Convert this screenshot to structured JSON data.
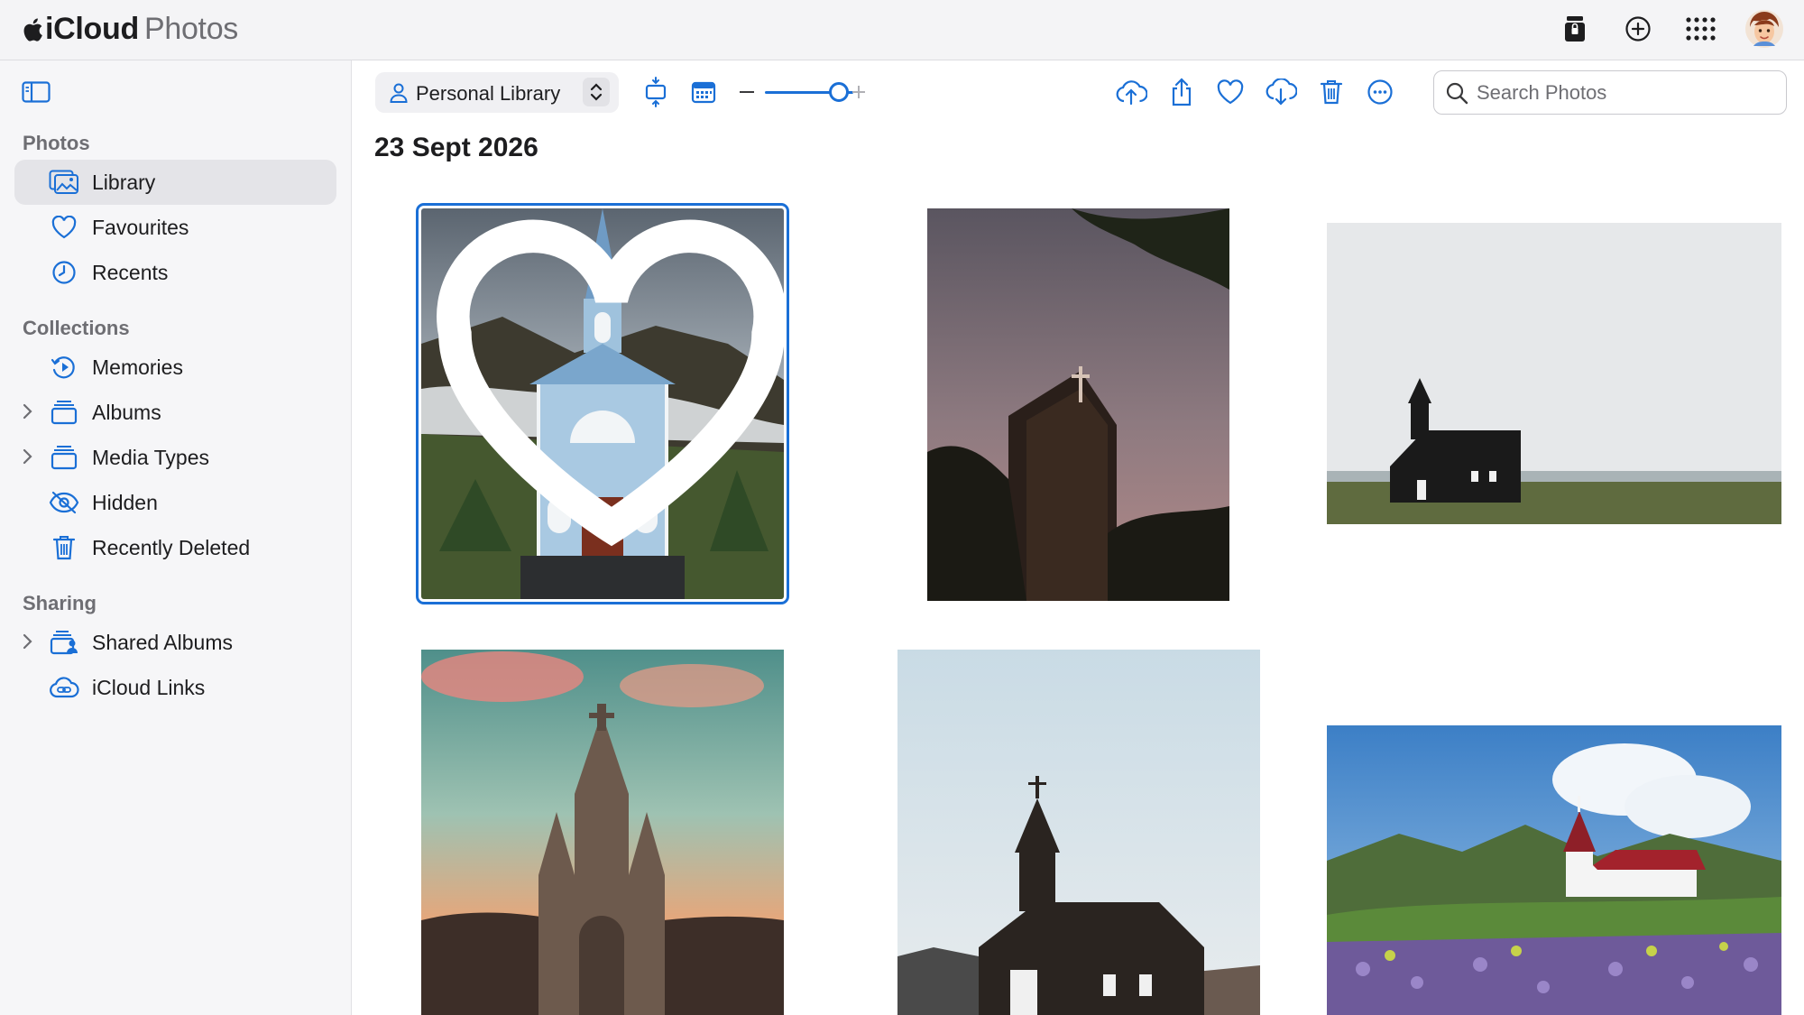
{
  "app": {
    "brand_main": "iCloud",
    "brand_sub": "Photos",
    "top_icons": [
      "icloud-drive-lock-icon",
      "add-icon",
      "app-grid-icon",
      "avatar"
    ]
  },
  "sidebar": {
    "sections": {
      "photos": "Photos",
      "collections": "Collections",
      "sharing": "Sharing"
    },
    "items": [
      {
        "label": "Library",
        "icon": "library-icon",
        "active": true
      },
      {
        "label": "Favourites",
        "icon": "heart-icon"
      },
      {
        "label": "Recents",
        "icon": "clock-icon"
      },
      {
        "label": "Memories",
        "icon": "memories-icon"
      },
      {
        "label": "Albums",
        "icon": "album-icon",
        "expandable": true
      },
      {
        "label": "Media Types",
        "icon": "album-icon",
        "expandable": true
      },
      {
        "label": "Hidden",
        "icon": "eye-slash-icon"
      },
      {
        "label": "Recently Deleted",
        "icon": "trash-icon"
      },
      {
        "label": "Shared Albums",
        "icon": "shared-album-icon",
        "expandable": true
      },
      {
        "label": "iCloud Links",
        "icon": "cloud-link-icon"
      }
    ]
  },
  "toolbar": {
    "library_selector": "Personal Library",
    "zoom_level": 0.75,
    "actions": [
      "upload-icon",
      "share-icon",
      "favourite-icon",
      "download-icon",
      "delete-icon",
      "more-icon"
    ],
    "search_placeholder": "Search Photos"
  },
  "content": {
    "date_heading": "23 Sept 2026",
    "photos": [
      {
        "subject": "Blue wooden church with spire",
        "selected": true,
        "favourite": true
      },
      {
        "subject": "Church silhouette with cross at dusk"
      },
      {
        "subject": "Black church on open field"
      },
      {
        "subject": "Gothic cathedral at sunset"
      },
      {
        "subject": "Black wooden church against sky"
      },
      {
        "subject": "White church with red roof and lupins"
      }
    ]
  },
  "colors": {
    "accent": "#1a6fd6",
    "sidebar_bg": "#f6f6f8",
    "topbar_bg": "#f4f4f6"
  }
}
